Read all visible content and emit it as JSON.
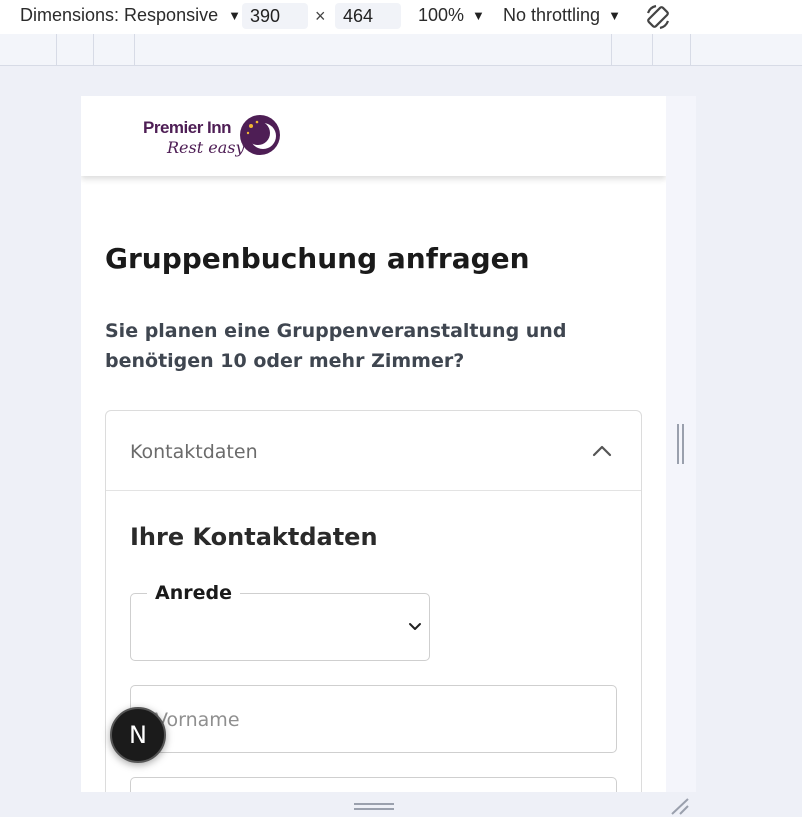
{
  "devtools": {
    "dimensions_label": "Dimensions: Responsive",
    "width_value": "390",
    "times": "×",
    "height_value": "464",
    "zoom_label": "100%",
    "throttling_label": "No throttling",
    "caret": "▼"
  },
  "brand": {
    "logo_line1": "Premier Inn",
    "logo_line2": "Rest easy",
    "primary_color": "#4e1e55"
  },
  "page": {
    "title": "Gruppenbuchung anfragen",
    "subtitle": "Sie planen eine Gruppenveranstaltung und benötigen 10 oder mehr Zimmer?"
  },
  "accordion": {
    "header": "Kontaktdaten",
    "section_title": "Ihre Kontaktdaten",
    "salutation_label": "Anrede",
    "salutation_value": "",
    "firstname_placeholder": "Vorname"
  },
  "floating": {
    "badge_letter": "N"
  }
}
